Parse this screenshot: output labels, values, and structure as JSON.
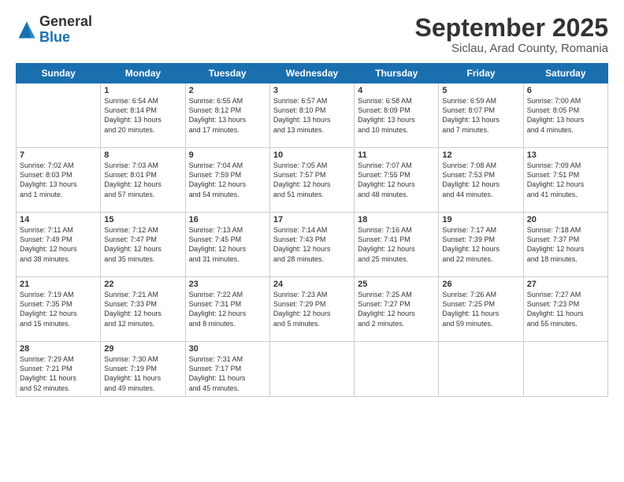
{
  "header": {
    "logo_general": "General",
    "logo_blue": "Blue",
    "title": "September 2025",
    "subtitle": "Siclau, Arad County, Romania"
  },
  "days_of_week": [
    "Sunday",
    "Monday",
    "Tuesday",
    "Wednesday",
    "Thursday",
    "Friday",
    "Saturday"
  ],
  "weeks": [
    [
      {
        "day": "",
        "info": ""
      },
      {
        "day": "1",
        "info": "Sunrise: 6:54 AM\nSunset: 8:14 PM\nDaylight: 13 hours\nand 20 minutes."
      },
      {
        "day": "2",
        "info": "Sunrise: 6:55 AM\nSunset: 8:12 PM\nDaylight: 13 hours\nand 17 minutes."
      },
      {
        "day": "3",
        "info": "Sunrise: 6:57 AM\nSunset: 8:10 PM\nDaylight: 13 hours\nand 13 minutes."
      },
      {
        "day": "4",
        "info": "Sunrise: 6:58 AM\nSunset: 8:09 PM\nDaylight: 13 hours\nand 10 minutes."
      },
      {
        "day": "5",
        "info": "Sunrise: 6:59 AM\nSunset: 8:07 PM\nDaylight: 13 hours\nand 7 minutes."
      },
      {
        "day": "6",
        "info": "Sunrise: 7:00 AM\nSunset: 8:05 PM\nDaylight: 13 hours\nand 4 minutes."
      }
    ],
    [
      {
        "day": "7",
        "info": "Sunrise: 7:02 AM\nSunset: 8:03 PM\nDaylight: 13 hours\nand 1 minute."
      },
      {
        "day": "8",
        "info": "Sunrise: 7:03 AM\nSunset: 8:01 PM\nDaylight: 12 hours\nand 57 minutes."
      },
      {
        "day": "9",
        "info": "Sunrise: 7:04 AM\nSunset: 7:59 PM\nDaylight: 12 hours\nand 54 minutes."
      },
      {
        "day": "10",
        "info": "Sunrise: 7:05 AM\nSunset: 7:57 PM\nDaylight: 12 hours\nand 51 minutes."
      },
      {
        "day": "11",
        "info": "Sunrise: 7:07 AM\nSunset: 7:55 PM\nDaylight: 12 hours\nand 48 minutes."
      },
      {
        "day": "12",
        "info": "Sunrise: 7:08 AM\nSunset: 7:53 PM\nDaylight: 12 hours\nand 44 minutes."
      },
      {
        "day": "13",
        "info": "Sunrise: 7:09 AM\nSunset: 7:51 PM\nDaylight: 12 hours\nand 41 minutes."
      }
    ],
    [
      {
        "day": "14",
        "info": "Sunrise: 7:11 AM\nSunset: 7:49 PM\nDaylight: 12 hours\nand 38 minutes."
      },
      {
        "day": "15",
        "info": "Sunrise: 7:12 AM\nSunset: 7:47 PM\nDaylight: 12 hours\nand 35 minutes."
      },
      {
        "day": "16",
        "info": "Sunrise: 7:13 AM\nSunset: 7:45 PM\nDaylight: 12 hours\nand 31 minutes."
      },
      {
        "day": "17",
        "info": "Sunrise: 7:14 AM\nSunset: 7:43 PM\nDaylight: 12 hours\nand 28 minutes."
      },
      {
        "day": "18",
        "info": "Sunrise: 7:16 AM\nSunset: 7:41 PM\nDaylight: 12 hours\nand 25 minutes."
      },
      {
        "day": "19",
        "info": "Sunrise: 7:17 AM\nSunset: 7:39 PM\nDaylight: 12 hours\nand 22 minutes."
      },
      {
        "day": "20",
        "info": "Sunrise: 7:18 AM\nSunset: 7:37 PM\nDaylight: 12 hours\nand 18 minutes."
      }
    ],
    [
      {
        "day": "21",
        "info": "Sunrise: 7:19 AM\nSunset: 7:35 PM\nDaylight: 12 hours\nand 15 minutes."
      },
      {
        "day": "22",
        "info": "Sunrise: 7:21 AM\nSunset: 7:33 PM\nDaylight: 12 hours\nand 12 minutes."
      },
      {
        "day": "23",
        "info": "Sunrise: 7:22 AM\nSunset: 7:31 PM\nDaylight: 12 hours\nand 8 minutes."
      },
      {
        "day": "24",
        "info": "Sunrise: 7:23 AM\nSunset: 7:29 PM\nDaylight: 12 hours\nand 5 minutes."
      },
      {
        "day": "25",
        "info": "Sunrise: 7:25 AM\nSunset: 7:27 PM\nDaylight: 12 hours\nand 2 minutes."
      },
      {
        "day": "26",
        "info": "Sunrise: 7:26 AM\nSunset: 7:25 PM\nDaylight: 11 hours\nand 59 minutes."
      },
      {
        "day": "27",
        "info": "Sunrise: 7:27 AM\nSunset: 7:23 PM\nDaylight: 11 hours\nand 55 minutes."
      }
    ],
    [
      {
        "day": "28",
        "info": "Sunrise: 7:29 AM\nSunset: 7:21 PM\nDaylight: 11 hours\nand 52 minutes."
      },
      {
        "day": "29",
        "info": "Sunrise: 7:30 AM\nSunset: 7:19 PM\nDaylight: 11 hours\nand 49 minutes."
      },
      {
        "day": "30",
        "info": "Sunrise: 7:31 AM\nSunset: 7:17 PM\nDaylight: 11 hours\nand 45 minutes."
      },
      {
        "day": "",
        "info": ""
      },
      {
        "day": "",
        "info": ""
      },
      {
        "day": "",
        "info": ""
      },
      {
        "day": "",
        "info": ""
      }
    ]
  ]
}
